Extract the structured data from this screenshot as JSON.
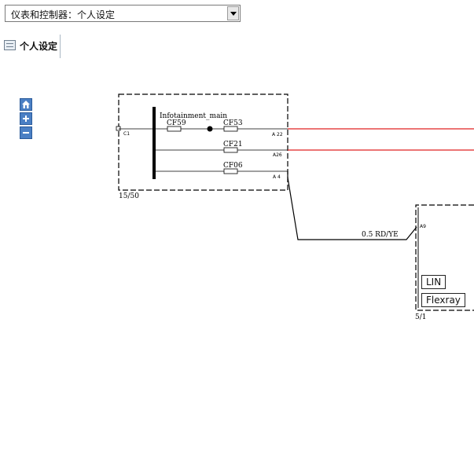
{
  "toolbar": {
    "selector_value": "仪表和控制器：个人设定"
  },
  "page": {
    "title": "个人设定"
  },
  "zoom": {
    "home_icon": "home-icon",
    "zoom_in_icon": "plus-icon",
    "zoom_out_icon": "minus-icon"
  },
  "diagram": {
    "module_main": {
      "name": "Infotainment_main",
      "connector": "C1",
      "ref": "15/50",
      "fuses": [
        "CF59",
        "CF53",
        "CF21",
        "CF06"
      ],
      "pins": [
        "A 22",
        "A26",
        "A 4"
      ]
    },
    "wire": {
      "label": "0.5 RD/YE"
    },
    "module_right": {
      "pin": "A9",
      "ref": "5/1",
      "buses": [
        "LIN",
        "Flexray"
      ]
    },
    "colors": {
      "red_wire": "#e02020",
      "black_wire": "#000000"
    }
  }
}
